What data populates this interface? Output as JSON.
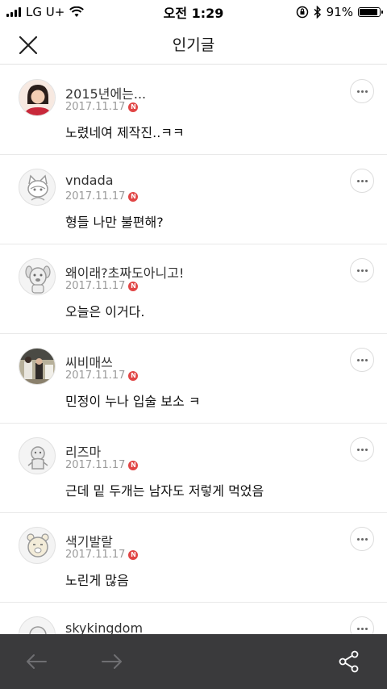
{
  "status_bar": {
    "carrier": "LG U+",
    "time": "오전 1:29",
    "battery": "91%",
    "battery_level": 0.91
  },
  "header": {
    "title": "인기글"
  },
  "posts": [
    {
      "name": "2015년에는...",
      "date": "2017.11.17",
      "badge": "N",
      "text": "노렸네여 제작진..ㅋㅋ",
      "avatar_icon": "profile-photo"
    },
    {
      "name": "vndada",
      "date": "2017.11.17",
      "badge": "N",
      "text": "형들 나만 불편해?",
      "avatar_icon": "cat-character"
    },
    {
      "name": "왜이래?초짜도아니고!",
      "date": "2017.11.17",
      "badge": "N",
      "text": "오늘은 이거다.",
      "avatar_icon": "dog-character"
    },
    {
      "name": "씨비매쓰",
      "date": "2017.11.17",
      "badge": "N",
      "text": "민정이 누나 입술 보소 ㅋ",
      "avatar_icon": "photo"
    },
    {
      "name": "리즈마",
      "date": "2017.11.17",
      "badge": "N",
      "text": "근데 밑 두개는 남자도 저렇게 먹었음",
      "avatar_icon": "character"
    },
    {
      "name": "색기발랄",
      "date": "2017.11.17",
      "badge": "N",
      "text": "노린게 많음",
      "avatar_icon": "bear-character"
    },
    {
      "name": "skykingdom",
      "date": "",
      "badge": "",
      "text": "",
      "avatar_icon": "character"
    }
  ],
  "toolbar": {
    "back_icon": "arrow-left-icon",
    "forward_icon": "arrow-right-icon",
    "share_icon": "share-icon"
  }
}
